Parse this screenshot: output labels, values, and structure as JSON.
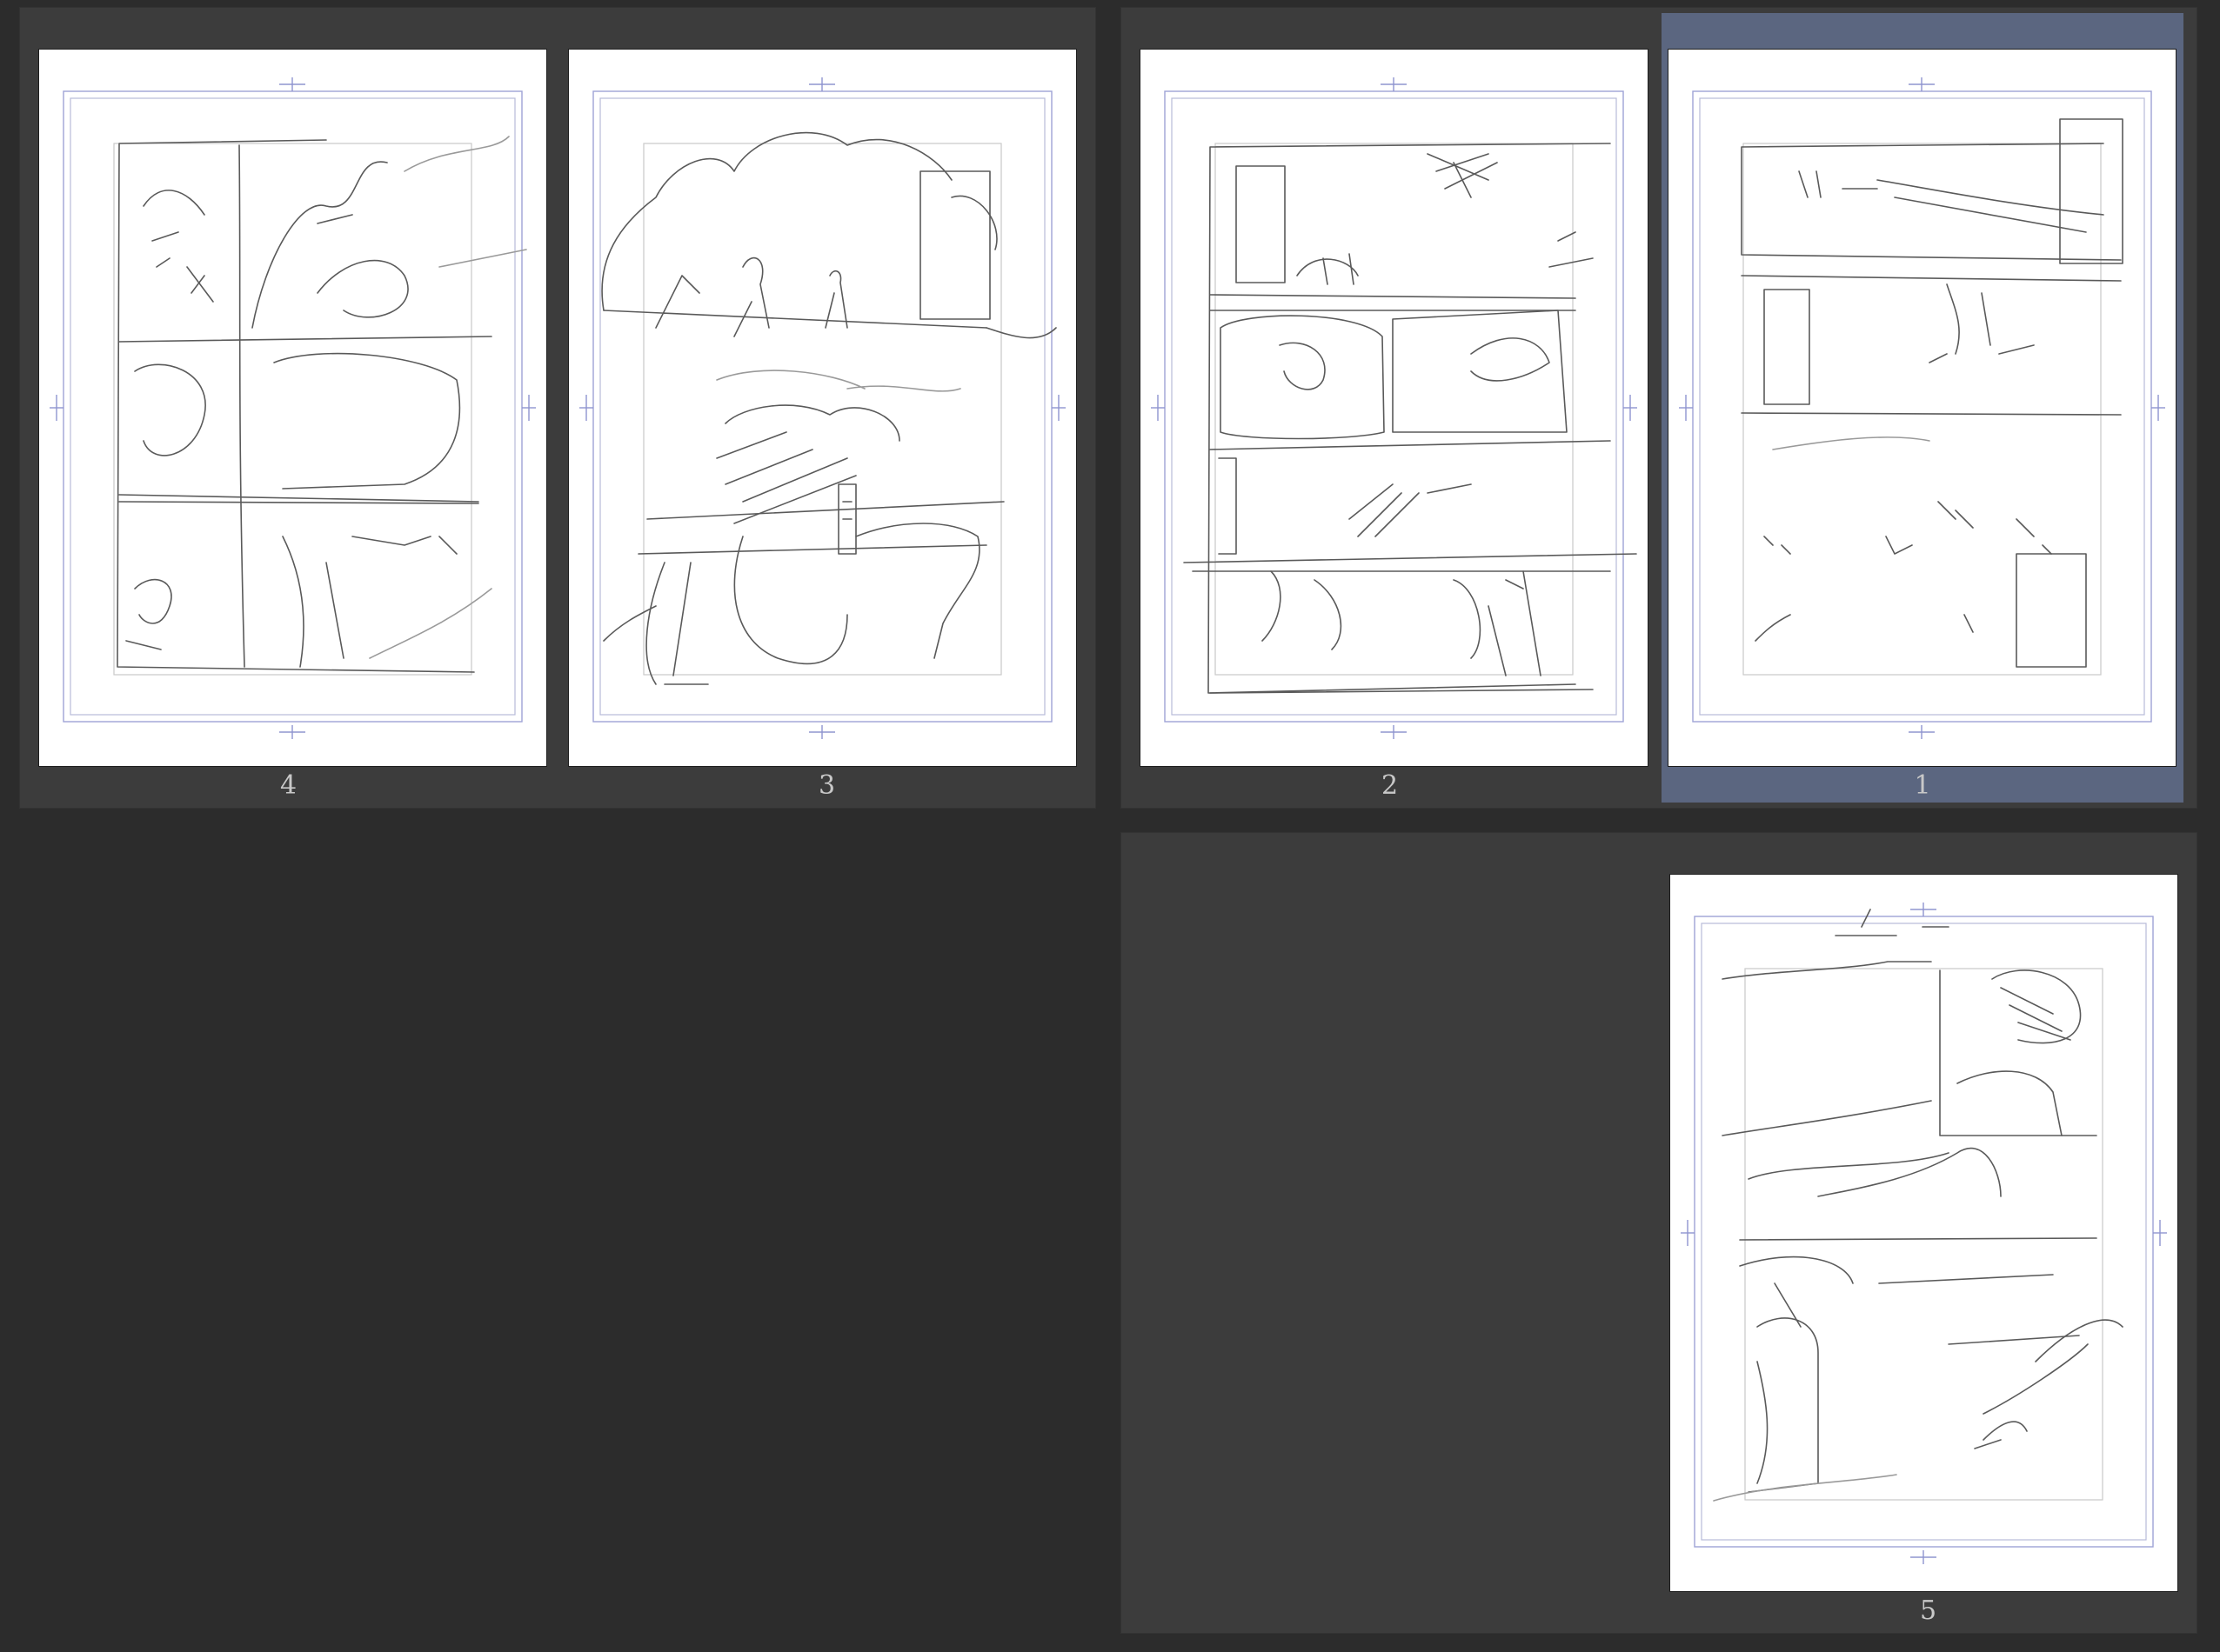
{
  "spreads": [
    {
      "id": "spread-4-3",
      "pages": [
        {
          "number": "4"
        },
        {
          "number": "3"
        }
      ]
    },
    {
      "id": "spread-2-1",
      "pages": [
        {
          "number": "2"
        },
        {
          "number": "1",
          "selected": true
        }
      ]
    },
    {
      "id": "spread-5",
      "pages": [
        {
          "number": "5"
        }
      ]
    }
  ],
  "colors": {
    "workspace": "#2c2c2c",
    "spread": "#3c3c3c",
    "selection": "#5b6680",
    "paper": "#ffffff",
    "guide": "#9ea3d6"
  }
}
